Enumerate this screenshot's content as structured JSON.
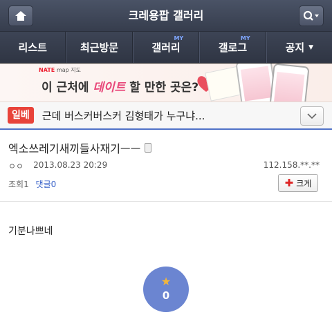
{
  "header": {
    "title": "크레용팝 갤러리",
    "home_icon": "home-icon",
    "search_icon": "search-icon"
  },
  "nav": {
    "items": [
      {
        "label": "리스트",
        "badge": ""
      },
      {
        "label": "최근방문",
        "badge": ""
      },
      {
        "label": "갤러리",
        "badge": "MY"
      },
      {
        "label": "갤로그",
        "badge": "MY"
      },
      {
        "label": "공지",
        "badge": "",
        "caret": "▼"
      }
    ]
  },
  "banner": {
    "brand": "NATE",
    "brand_sub": "map 지도",
    "copy_pre": "이 근처에 ",
    "copy_highlight": "데이트",
    "copy_post": " 할 만한 곳은?"
  },
  "hot": {
    "badge": "일베",
    "text": "근데 버스커버스커 김형태가 누구냐..."
  },
  "post": {
    "title": "엑소쓰레기새끼들사재기ㅡㅡ",
    "author": "ㅇㅇ",
    "date": "2013.08.23 20:29",
    "ip": "112.158.**.**",
    "views_label": "조회1",
    "comments_label": "댓글0",
    "big_label": "크게",
    "body": "기분나쁘네",
    "recommend_count": "0"
  },
  "colors": {
    "accent": "#4f71c7",
    "hot_badge": "#e8433a",
    "recommend": "#6b85d1"
  }
}
